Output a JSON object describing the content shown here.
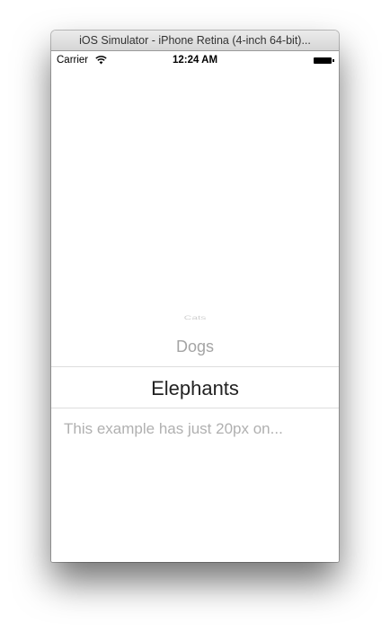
{
  "window": {
    "title": "iOS Simulator - iPhone Retina (4-inch 64-bit)..."
  },
  "statusbar": {
    "carrier": "Carrier",
    "wifi_icon": "wifi-icon",
    "time": "12:24 AM",
    "battery_icon": "battery-icon"
  },
  "picker": {
    "items": [
      "Cats",
      "Dogs",
      "Elephants",
      "This example has just 20px on..."
    ],
    "selected": "Elephants"
  }
}
